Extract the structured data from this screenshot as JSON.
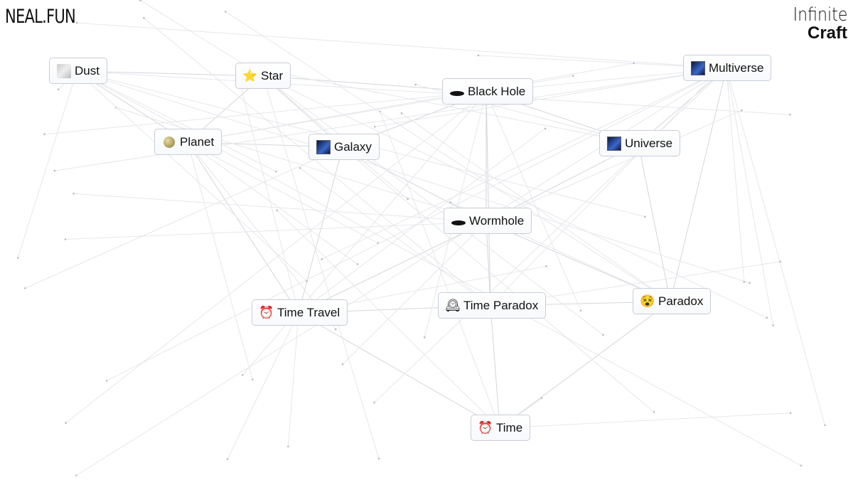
{
  "header": {
    "brand": "NEAL.FUN",
    "title_line1": "Infinite",
    "title_line2": "Craft"
  },
  "elements": [
    {
      "id": "dust",
      "label": "Dust",
      "icon": "dust-icon",
      "glyph": ""
    },
    {
      "id": "star",
      "label": "Star",
      "icon": "star-icon",
      "glyph": "⭐"
    },
    {
      "id": "planet",
      "label": "Planet",
      "icon": "planet-icon",
      "glyph": ""
    },
    {
      "id": "galaxy",
      "label": "Galaxy",
      "icon": "galaxy-icon",
      "glyph": ""
    },
    {
      "id": "black-hole",
      "label": "Black Hole",
      "icon": "black-hole-icon",
      "glyph": ""
    },
    {
      "id": "multiverse",
      "label": "Multiverse",
      "icon": "galaxy-icon",
      "glyph": ""
    },
    {
      "id": "universe",
      "label": "Universe",
      "icon": "galaxy-icon",
      "glyph": ""
    },
    {
      "id": "wormhole",
      "label": "Wormhole",
      "icon": "hole-icon",
      "glyph": ""
    },
    {
      "id": "time-travel",
      "label": "Time Travel",
      "icon": "alarm-clock-icon",
      "glyph": "⏰"
    },
    {
      "id": "time-paradox",
      "label": "Time Paradox",
      "icon": "mantel-clock-icon",
      "glyph": "🕰"
    },
    {
      "id": "paradox",
      "label": "Paradox",
      "icon": "dizzy-face-icon",
      "glyph": "😵"
    },
    {
      "id": "time",
      "label": "Time",
      "icon": "alarm-clock-icon",
      "glyph": "⏰"
    }
  ]
}
